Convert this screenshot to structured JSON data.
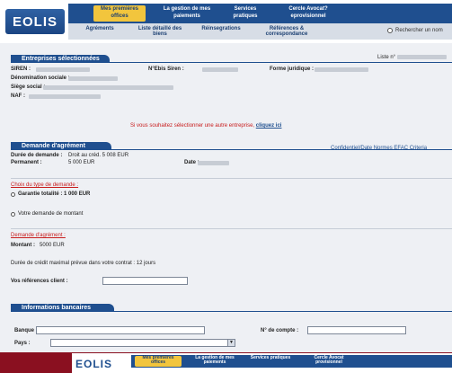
{
  "header": {
    "logo": "EOLIS",
    "top_tabs": [
      "Mes premières offices",
      "La gestion de mes paiements",
      "Services pratiques",
      "Cercle Avocat?eprovisionnel"
    ],
    "sub_tabs": [
      "Agréments",
      "Liste détaillé des biens",
      "Réinsegrations",
      "Références & correspondance"
    ],
    "checkbox_label": "Rechercher un nom"
  },
  "entreprises": {
    "title": "Entreprises sélectionnées",
    "right_info": "Liste n°",
    "siren_label": "SIREN :",
    "ebis_label": "N°Ebis Siren :",
    "forme_label": "Forme juridique :",
    "denomination_label": "Dénomination sociale :",
    "siege_label": "Siège social :",
    "naf_label": "NAF :",
    "notice": "Si vous souhaitez sélectionner une autre entreprise,",
    "notice_link": "cliquez ici"
  },
  "demande": {
    "title": "Demande d'agrément",
    "right_info": "Confidentiel/Date Normes EFAC Criteria",
    "duration_label": "Durée de demande :",
    "duration_value": "Droit au créd. 5 008 EUR",
    "perm_label": "Permanent :",
    "perm_value": "5 000 EUR",
    "date_label": "Date :",
    "choice_label": "Choix du type de demande :",
    "option1": "Garantie totalité : 1 000 EUR",
    "option2": "Votre demande de montant",
    "montant_section": "Demande d'agrément :",
    "montant_label": "Montant :",
    "montant_value": "5000 EUR",
    "credit_line": "Durée de crédit maximal prévue dans votre contrat : 12 jours",
    "reference_label": "Vos références client :"
  },
  "bancaires": {
    "title": "Informations bancaires",
    "banque_label": "Banque :",
    "compte_label": "N° de compte :",
    "pays_label": "Pays :"
  },
  "overlay": {
    "logo": "EOLIS",
    "tabs": [
      "Mes premières offices",
      "La gestion de mes paiements",
      "Services pratiques",
      "Cercle Avocat provisionnel"
    ]
  }
}
